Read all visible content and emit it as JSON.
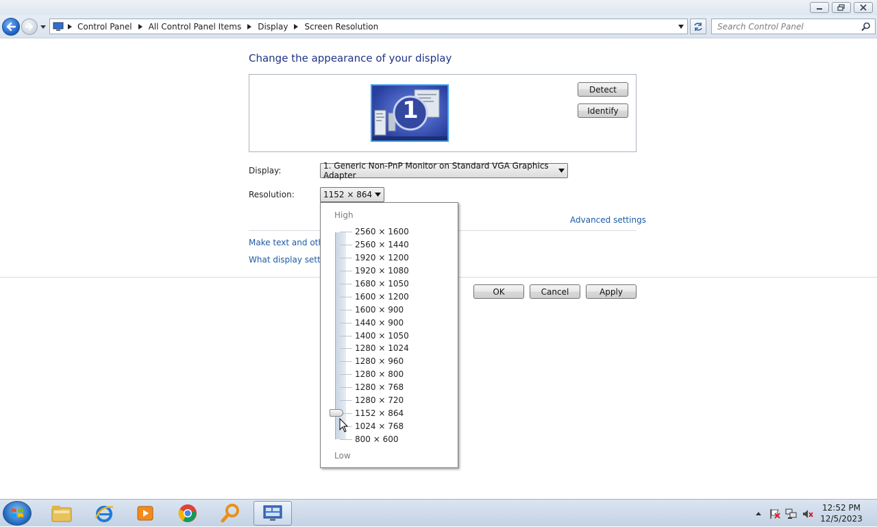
{
  "window": {
    "controls": {
      "minimize": "minimize",
      "restore": "restore",
      "close": "close"
    }
  },
  "address_bar": {
    "breadcrumbs": [
      "Control Panel",
      "All Control Panel Items",
      "Display",
      "Screen Resolution"
    ],
    "search_placeholder": "Search Control Panel"
  },
  "main": {
    "heading": "Change the appearance of your display",
    "monitor_number": "1",
    "detect_label": "Detect",
    "identify_label": "Identify",
    "display_label": "Display:",
    "display_value": "1. Generic Non-PnP Monitor on Standard VGA Graphics Adapter",
    "resolution_label": "Resolution:",
    "resolution_value": "1152 × 864",
    "advanced_link": "Advanced settings",
    "link_text_size": "Make text and other",
    "link_display_settings": "What display setting",
    "ok_label": "OK",
    "cancel_label": "Cancel",
    "apply_label": "Apply"
  },
  "resolution_dropdown": {
    "high_label": "High",
    "low_label": "Low",
    "options": [
      "2560 × 1600",
      "2560 × 1440",
      "1920 × 1200",
      "1920 × 1080",
      "1680 × 1050",
      "1600 × 1200",
      "1600 × 900",
      "1440 × 900",
      "1400 × 1050",
      "1280 × 1024",
      "1280 × 960",
      "1280 × 800",
      "1280 × 768",
      "1280 × 720",
      "1152 × 864",
      "1024 × 768",
      "800 × 600"
    ],
    "selected": "1152 × 864"
  },
  "taskbar": {
    "pinned": [
      "windows-explorer",
      "internet-explorer",
      "media-player",
      "chrome",
      "search-magnifier",
      "display-settings"
    ],
    "clock_time": "12:52 PM",
    "clock_date": "12/5/2023"
  },
  "colors": {
    "heading": "#1e3287",
    "link": "#1a5aa6",
    "taskbar": "#c3d2e4"
  }
}
